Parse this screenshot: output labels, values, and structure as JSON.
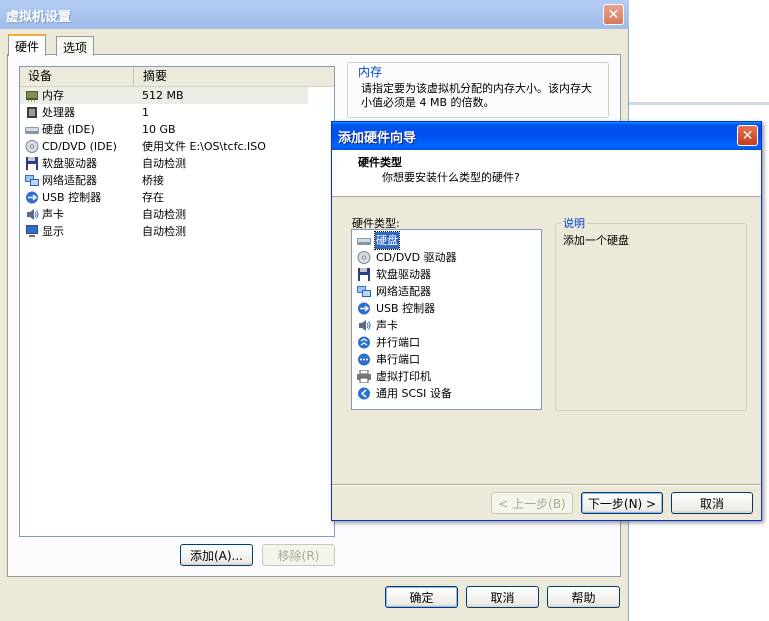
{
  "main_window": {
    "title": "虚拟机设置",
    "tabs": [
      {
        "label": "硬件"
      },
      {
        "label": "选项"
      }
    ],
    "device_list": {
      "headers": {
        "device": "设备",
        "summary": "摘要"
      },
      "rows": [
        {
          "name": "内存",
          "summary": "512 MB",
          "icon": "memory-icon"
        },
        {
          "name": "处理器",
          "summary": "1",
          "icon": "processor-icon"
        },
        {
          "name": "硬盘 (IDE)",
          "summary": "10 GB",
          "icon": "hard-disk-icon"
        },
        {
          "name": "CD/DVD (IDE)",
          "summary": "使用文件 E:\\OS\\tcfc.ISO",
          "icon": "cd-dvd-icon"
        },
        {
          "name": "软盘驱动器",
          "summary": "自动检测",
          "icon": "floppy-icon"
        },
        {
          "name": "网络适配器",
          "summary": "桥接",
          "icon": "network-adapter-icon"
        },
        {
          "name": "USB 控制器",
          "summary": "存在",
          "icon": "usb-icon"
        },
        {
          "name": "声卡",
          "summary": "自动检测",
          "icon": "sound-card-icon"
        },
        {
          "name": "显示",
          "summary": "自动检测",
          "icon": "display-icon"
        }
      ]
    },
    "memory_group": {
      "title": "内存",
      "description": "请指定要为该虚拟机分配的内存大小。该内存大小值必须是 4 MB 的倍数。"
    },
    "buttons": {
      "add": "添加(A)...",
      "remove": "移除(R)",
      "ok": "确定",
      "cancel": "取消",
      "help": "帮助"
    }
  },
  "wizard": {
    "title": "添加硬件向导",
    "header_title": "硬件类型",
    "header_subtitle": "你想要安装什么类型的硬件?",
    "list_label": "硬件类型:",
    "hardware_types": [
      {
        "name": "硬盘",
        "icon": "hard-disk-icon",
        "selected": true
      },
      {
        "name": "CD/DVD 驱动器",
        "icon": "cd-dvd-icon"
      },
      {
        "name": "软盘驱动器",
        "icon": "floppy-icon"
      },
      {
        "name": "网络适配器",
        "icon": "network-adapter-icon"
      },
      {
        "name": "USB 控制器",
        "icon": "usb-icon"
      },
      {
        "name": "声卡",
        "icon": "sound-card-icon"
      },
      {
        "name": "并行端口",
        "icon": "parallel-port-icon"
      },
      {
        "name": "串行端口",
        "icon": "serial-port-icon"
      },
      {
        "name": "虚拟打印机",
        "icon": "printer-icon"
      },
      {
        "name": "通用 SCSI 设备",
        "icon": "scsi-icon"
      }
    ],
    "description_group": {
      "title": "说明",
      "text": "添加一个硬盘"
    },
    "buttons": {
      "back": "< 上一步(B)",
      "next": "下一步(N) >",
      "cancel": "取消"
    }
  }
}
